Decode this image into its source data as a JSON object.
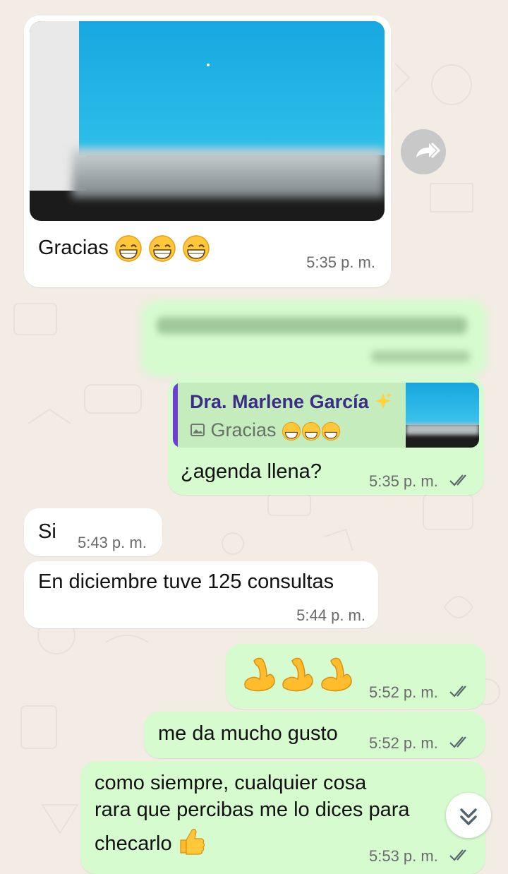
{
  "colors": {
    "background": "#f2ece4",
    "incoming_bubble": "#ffffff",
    "outgoing_bubble": "#d6fbcf",
    "quote_bar": "#6b3fd1",
    "quote_name": "#3b2d86",
    "tick": "#5b6b6b"
  },
  "messages": [
    {
      "id": "m1",
      "direction": "incoming",
      "type": "image",
      "caption": "Gracias",
      "emoji": "grinning-face x3",
      "time": "5:35 p. m."
    },
    {
      "id": "m2",
      "direction": "outgoing",
      "type": "text",
      "text": "",
      "note": "blurred",
      "time": ""
    },
    {
      "id": "m3",
      "direction": "outgoing",
      "type": "reply",
      "quote": {
        "author": "Dra. Marlene García",
        "author_emoji": "sparkles",
        "caption": "Gracias",
        "caption_icon": "image-icon"
      },
      "text": "¿agenda llena?",
      "time": "5:35 p. m.",
      "status": "delivered"
    },
    {
      "id": "m4",
      "direction": "incoming",
      "type": "text",
      "text": "Si",
      "time": "5:43 p. m."
    },
    {
      "id": "m5",
      "direction": "incoming",
      "type": "text",
      "text": "En diciembre tuve 125 consultas",
      "time": "5:44 p. m."
    },
    {
      "id": "m6",
      "direction": "outgoing",
      "type": "emoji",
      "emoji": "flexed-biceps x3",
      "time": "5:52 p. m.",
      "status": "delivered"
    },
    {
      "id": "m7",
      "direction": "outgoing",
      "type": "text",
      "text": "me da mucho gusto",
      "time": "5:52 p. m.",
      "status": "delivered"
    },
    {
      "id": "m8",
      "direction": "outgoing",
      "type": "text",
      "lines": [
        "como siempre, cualquier cosa",
        "rara que percibas me lo dices para",
        "checarlo"
      ],
      "emoji": "thumbs-up",
      "time": "5:53 p. m.",
      "status": "delivered"
    }
  ],
  "controls": {
    "forward_icon": "forward-icon",
    "scroll_down_icon": "double-chevron-down-icon"
  }
}
